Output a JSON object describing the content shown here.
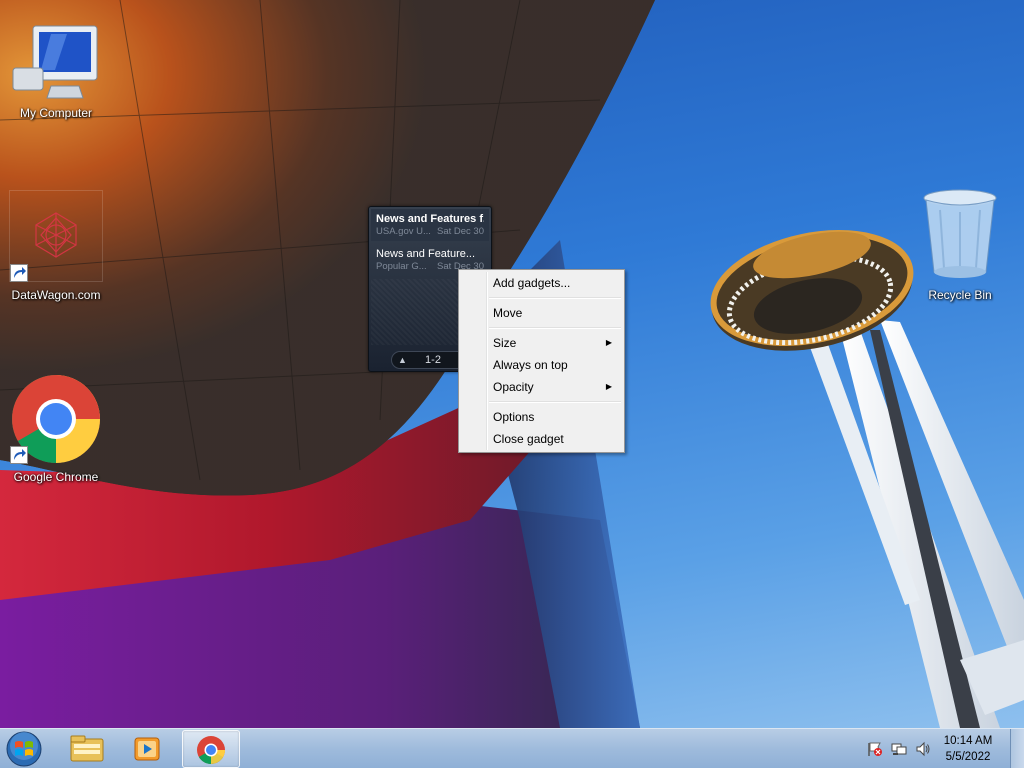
{
  "desktop_icons": {
    "my_computer": "My Computer",
    "datawagon": "DataWagon.com",
    "chrome": "Google Chrome",
    "recycle_bin": "Recycle Bin"
  },
  "gadget": {
    "feed_items": [
      {
        "title": "News and Features f...",
        "source": "USA.gov U...",
        "date": "Sat Dec 30"
      },
      {
        "title": "News and Feature...",
        "source": "Popular G...",
        "date": "Sat Dec 30"
      }
    ],
    "page_indicator": "1-2"
  },
  "context_menu": {
    "items": [
      {
        "label": "Add gadgets...",
        "submenu": false
      },
      {
        "label": "Move",
        "submenu": false
      },
      {
        "label": "Size",
        "submenu": true
      },
      {
        "label": "Always on top",
        "submenu": false
      },
      {
        "label": "Opacity",
        "submenu": true
      },
      {
        "label": "Options",
        "submenu": false
      },
      {
        "label": "Close gadget",
        "submenu": false
      }
    ]
  },
  "taskbar": {
    "start_icon": "windows-start-orb",
    "pinned": [
      "file-explorer-icon",
      "media-player-icon",
      "chrome-icon"
    ],
    "active_app": "Google Chrome",
    "tray_icons": [
      "action-center-flag-icon",
      "network-icon",
      "volume-icon"
    ],
    "clock_time": "10:14 AM",
    "clock_date": "5/5/2022"
  },
  "colors": {
    "sky": "#2f7ad6",
    "building_dark": "#2e2a28",
    "building_orange": "#c8561a",
    "menu_bg": "#f0f0f0",
    "taskbar": "#9fbbdc"
  }
}
